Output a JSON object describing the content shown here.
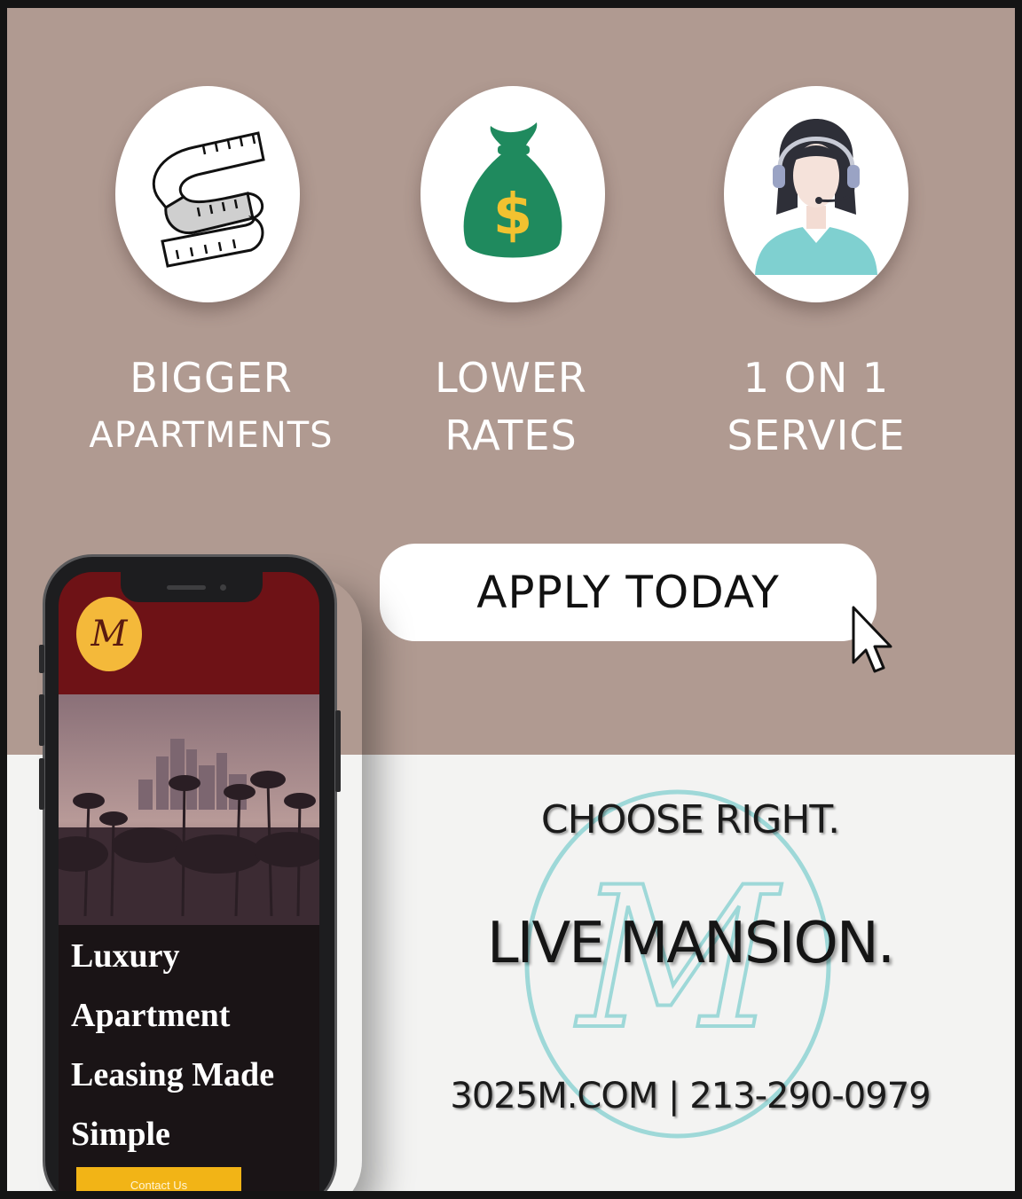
{
  "features": [
    {
      "icon": "measuring-tape-icon",
      "line1": "BIGGER",
      "line2": "APARTMENTS"
    },
    {
      "icon": "money-bag-icon",
      "line1": "LOWER",
      "line2": "RATES"
    },
    {
      "icon": "customer-service-agent-icon",
      "line1": "1 ON 1",
      "line2": "SERVICE"
    }
  ],
  "cta": {
    "label": "APPLY TODAY"
  },
  "tagline": {
    "line1": "CHOOSE RIGHT.",
    "line2": "LIVE MANSION."
  },
  "contact": {
    "text": "3025M.COM | 213-290-0979"
  },
  "phone": {
    "logo": "M",
    "hero_lines": [
      "Luxury",
      "Apartment",
      "Leasing Made",
      "Simple"
    ],
    "button_label": "Contact Us"
  },
  "colors": {
    "top_background": "#b09a91",
    "bottom_background": "#f3f3f2",
    "money_bag": "#1f8a5e",
    "dollar_sign": "#f2c230",
    "header_maroon": "#6e1216",
    "logo_gold": "#f4b93a",
    "watermark": "#9ed8d8"
  }
}
